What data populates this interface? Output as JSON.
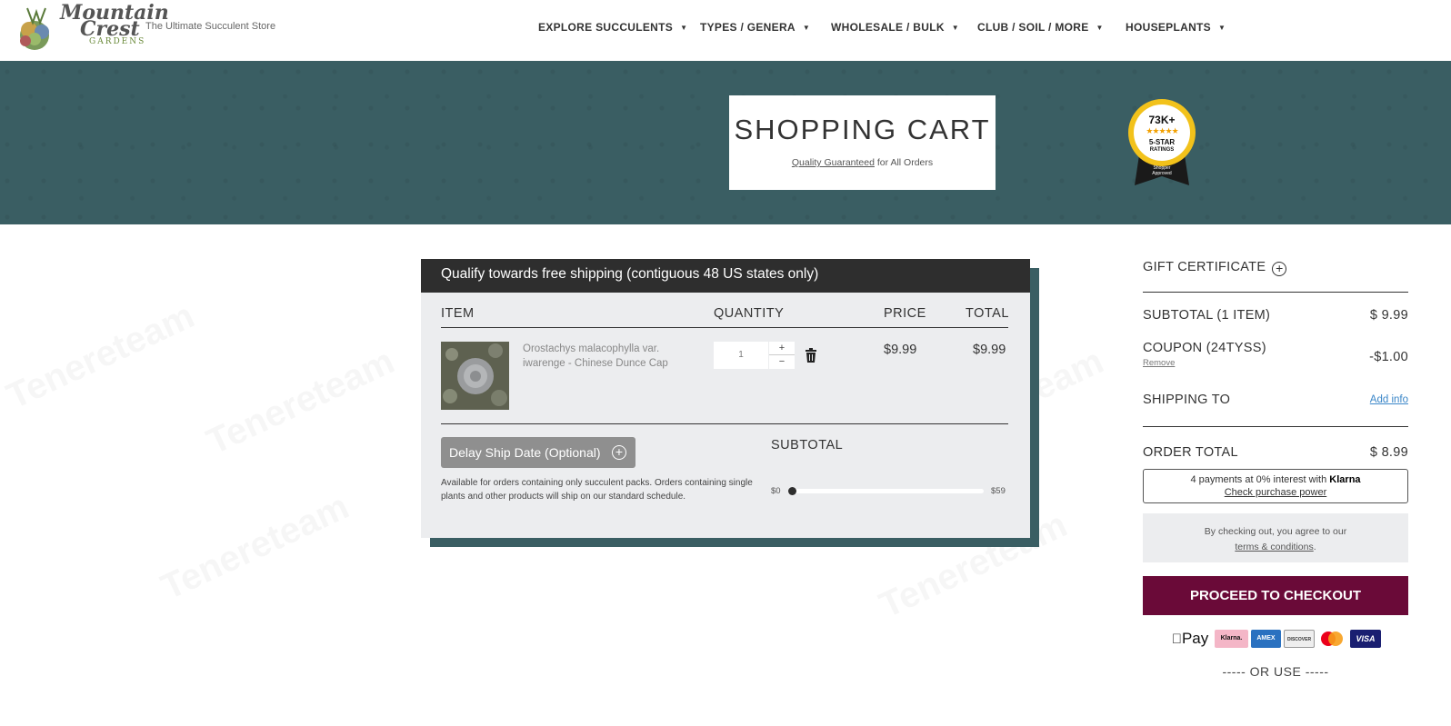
{
  "header": {
    "logo": {
      "line1": "Mountain",
      "line2": "Crest",
      "line3": "GARDENS"
    },
    "tagline": "The Ultimate Succulent Store",
    "nav": [
      {
        "label": "EXPLORE SUCCULENTS"
      },
      {
        "label": "TYPES / GENERA"
      },
      {
        "label": "WHOLESALE / BULK"
      },
      {
        "label": "CLUB / SOIL / MORE"
      },
      {
        "label": "HOUSEPLANTS"
      }
    ]
  },
  "banner": {
    "title": "SHOPPING CART",
    "subtitle_link": "Quality Guaranteed",
    "subtitle_rest": " for All Orders",
    "badge": {
      "count": "73K+",
      "stars": "★★★★★",
      "line1": "5-STAR",
      "line2": "RATINGS",
      "approved1": "Shopper",
      "approved2": "Approved"
    }
  },
  "cart": {
    "heading": "Qualify towards free shipping (contiguous 48 US states only)",
    "columns": {
      "item": "ITEM",
      "quantity": "QUANTITY",
      "price": "PRICE",
      "total": "TOTAL"
    },
    "item": {
      "name": "Orostachys malacophylla var. iwarenge - Chinese Dunce Cap",
      "quantity": "1",
      "plus": "+",
      "minus": "−",
      "price": "$9.99",
      "total": "$9.99"
    },
    "delay_button": "Delay Ship Date (Optional)",
    "delay_note": "Available for orders containing only succulent packs. Orders containing single plants and other products will ship on our standard schedule.",
    "subtotal_heading": "SUBTOTAL",
    "progress": {
      "min_label": "$0",
      "max_label": "$59",
      "value": 0
    }
  },
  "summary": {
    "gift_certificate": "GIFT CERTIFICATE",
    "subtotal_label": "SUBTOTAL (1 ITEM)",
    "subtotal_value": "$ 9.99",
    "coupon_label": "COUPON (24TYSS)",
    "coupon_value": "-$1.00",
    "remove": "Remove",
    "shipping_label": "SHIPPING TO",
    "add_info": "Add info",
    "order_total_label": "ORDER TOTAL",
    "order_total_value": "$ 8.99",
    "klarna_text": "4 payments at 0% interest with ",
    "klarna_brand": "Klarna",
    "klarna_link": "Check purchase power",
    "terms_text": "By checking out, you agree to our",
    "terms_link": "terms & conditions",
    "terms_end": ".",
    "checkout": "PROCEED TO CHECKOUT",
    "payments": [
      "Pay",
      "Klarna.",
      "AMEX",
      "DISCOVER",
      "mastercard",
      "VISA"
    ],
    "or_use": "----- OR USE -----"
  },
  "colors": {
    "teal": "#3a5e63",
    "checkout": "#6a0a38",
    "dark": "#2e2e2e",
    "link": "#3a86c8"
  }
}
